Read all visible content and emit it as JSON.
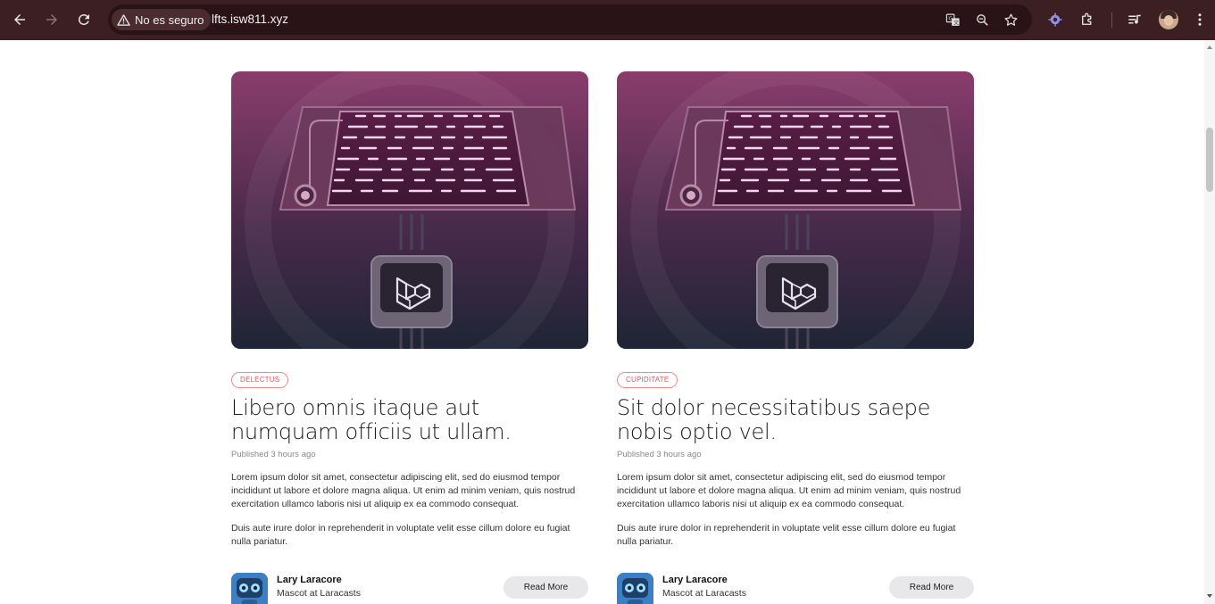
{
  "browser": {
    "security_label": "No es seguro",
    "url": "lfts.isw811.xyz"
  },
  "posts": [
    {
      "category": "Delectus",
      "title": "Libero omnis itaque aut numquam officiis ut ullam.",
      "published": "Published 3 hours ago",
      "paragraph1": "Lorem ipsum dolor sit amet, consectetur adipiscing elit, sed do eiusmod tempor incididunt ut labore et dolore magna aliqua. Ut enim ad minim veniam, quis nostrud exercitation ullamco laboris nisi ut aliquip ex ea commodo consequat.",
      "paragraph2": "Duis aute irure dolor in reprehenderit in voluptate velit esse cillum dolore eu fugiat nulla pariatur.",
      "author_name": "Lary Laracore",
      "author_role": "Mascot at Laracasts",
      "read_more": "Read More"
    },
    {
      "category": "Cupiditate",
      "title": "Sit dolor necessitatibus saepe nobis optio vel.",
      "published": "Published 3 hours ago",
      "paragraph1": "Lorem ipsum dolor sit amet, consectetur adipiscing elit, sed do eiusmod tempor incididunt ut labore et dolore magna aliqua. Ut enim ad minim veniam, quis nostrud exercitation ullamco laboris nisi ut aliquip ex ea commodo consequat.",
      "paragraph2": "Duis aute irure dolor in reprehenderit in voluptate velit esse cillum dolore eu fugiat nulla pariatur.",
      "author_name": "Lary Laracore",
      "author_role": "Mascot at Laracasts",
      "read_more": "Read More"
    }
  ],
  "colors": {
    "chrome_bg": "#3c1f22",
    "category_accent": "#e35a5a",
    "illustration_top": "#8a3d6c",
    "illustration_bottom": "#1e2535"
  },
  "icons": [
    "back-arrow-icon",
    "forward-arrow-icon",
    "reload-icon",
    "warning-icon",
    "translate-icon",
    "zoom-icon",
    "star-icon",
    "extension-gear-icon",
    "puzzle-icon",
    "media-queue-icon",
    "profile-avatar",
    "kebab-menu-icon"
  ]
}
